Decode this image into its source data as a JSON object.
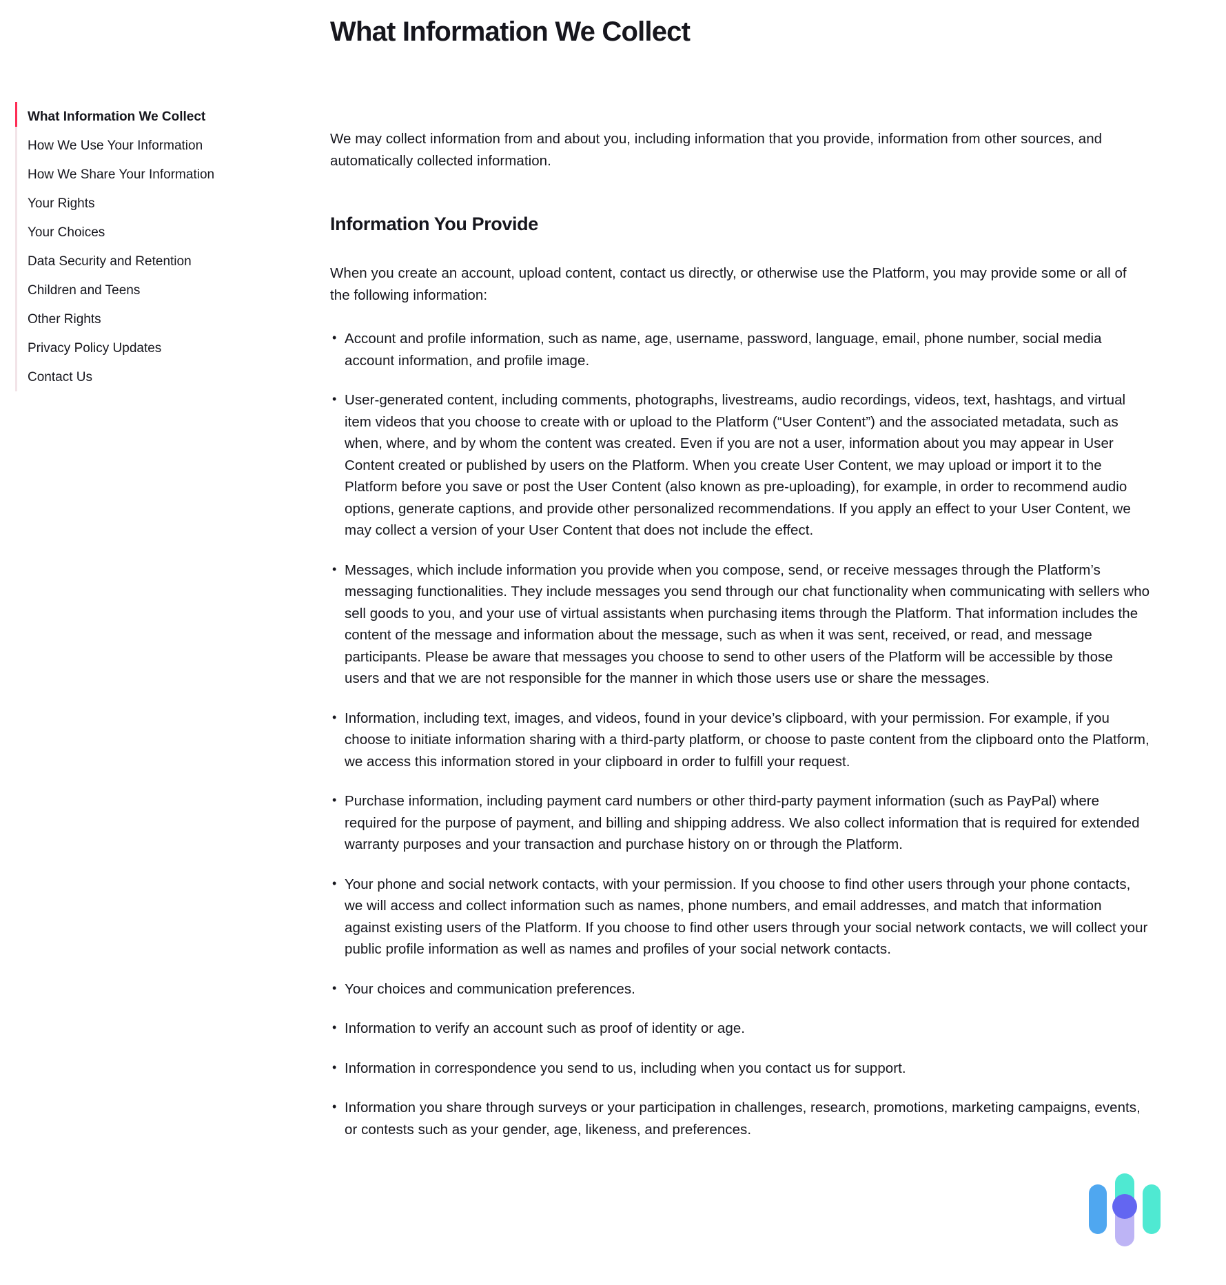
{
  "page": {
    "title": "What Information We Collect"
  },
  "sidebar": {
    "items": [
      {
        "label": "What Information We Collect",
        "active": true
      },
      {
        "label": "How We Use Your Information",
        "active": false
      },
      {
        "label": "How We Share Your Information",
        "active": false
      },
      {
        "label": "Your Rights",
        "active": false
      },
      {
        "label": "Your Choices",
        "active": false
      },
      {
        "label": "Data Security and Retention",
        "active": false
      },
      {
        "label": "Children and Teens",
        "active": false
      },
      {
        "label": "Other Rights",
        "active": false
      },
      {
        "label": "Privacy Policy Updates",
        "active": false
      },
      {
        "label": "Contact Us",
        "active": false
      }
    ]
  },
  "main": {
    "intro": "We may collect information from and about you, including information that you provide, information from other sources, and automatically collected information.",
    "section_heading": "Information You Provide",
    "section_intro": "When you create an account, upload content, contact us directly, or otherwise use the Platform, you may provide some or all of the following information:",
    "bullets": [
      "Account and profile information, such as name, age, username, password, language, email, phone number, social media account information, and profile image.",
      "User-generated content, including comments, photographs, livestreams, audio recordings, videos, text, hashtags, and virtual item videos that you choose to create with or upload to the Platform (“User Content”) and the associated metadata, such as when, where, and by whom the content was created. Even if you are not a user, information about you may appear in User Content created or published by users on the Platform. When you create User Content, we may upload or import it to the Platform before you save or post the User Content (also known as pre-uploading), for example, in order to recommend audio options, generate captions, and provide other personalized recommendations. If you apply an effect to your User Content, we may collect a version of your User Content that does not include the effect.",
      "Messages, which include information you provide when you compose, send, or receive messages through the Platform’s messaging functionalities. They include messages you send through our chat functionality when communicating with sellers who sell goods to you, and your use of virtual assistants when purchasing items through the Platform. That information includes the content of the message and information about the message, such as when it was sent, received, or read, and message participants. Please be aware that messages you choose to send to other users of the Platform will be accessible by those users and that we are not responsible for the manner in which those users use or share the messages.",
      "Information, including text, images, and videos, found in your device’s clipboard, with your permission. For example, if you choose to initiate information sharing with a third-party platform, or choose to paste content from the clipboard onto the Platform, we access this information stored in your clipboard in order to fulfill your request.",
      "Purchase information, including payment card numbers or other third-party payment information (such as PayPal) where required for the purpose of payment, and billing and shipping address. We also collect information that is required for extended warranty purposes and your transaction and purchase history on or through the Platform.",
      "Your phone and social network contacts, with your permission. If you choose to find other users through your phone contacts, we will access and collect information such as names, phone numbers, and email addresses, and match that information against existing users of the Platform. If you choose to find other users through your social network contacts, we will collect your public profile information as well as names and profiles of your social network contacts.",
      "Your choices and communication preferences.",
      "Information to verify an account such as proof of identity or age.",
      "Information in correspondence you send to us, including when you contact us for support.",
      "Information you share through surveys or your participation in challenges, research, promotions, marketing campaigns, events, or contests such as your gender, age, likeness, and preferences."
    ]
  },
  "logo": {
    "name": "brand-logo",
    "colors": {
      "blue_bar": "#4FA7F0",
      "mint_bar": "#4FE9D2",
      "lavender_bar": "#BDB4F5",
      "purple_dot": "#6366F1"
    }
  },
  "theme": {
    "accent": "#fe2c55",
    "text": "#16161d",
    "rail": "#f2e4e8",
    "background": "#ffffff"
  }
}
